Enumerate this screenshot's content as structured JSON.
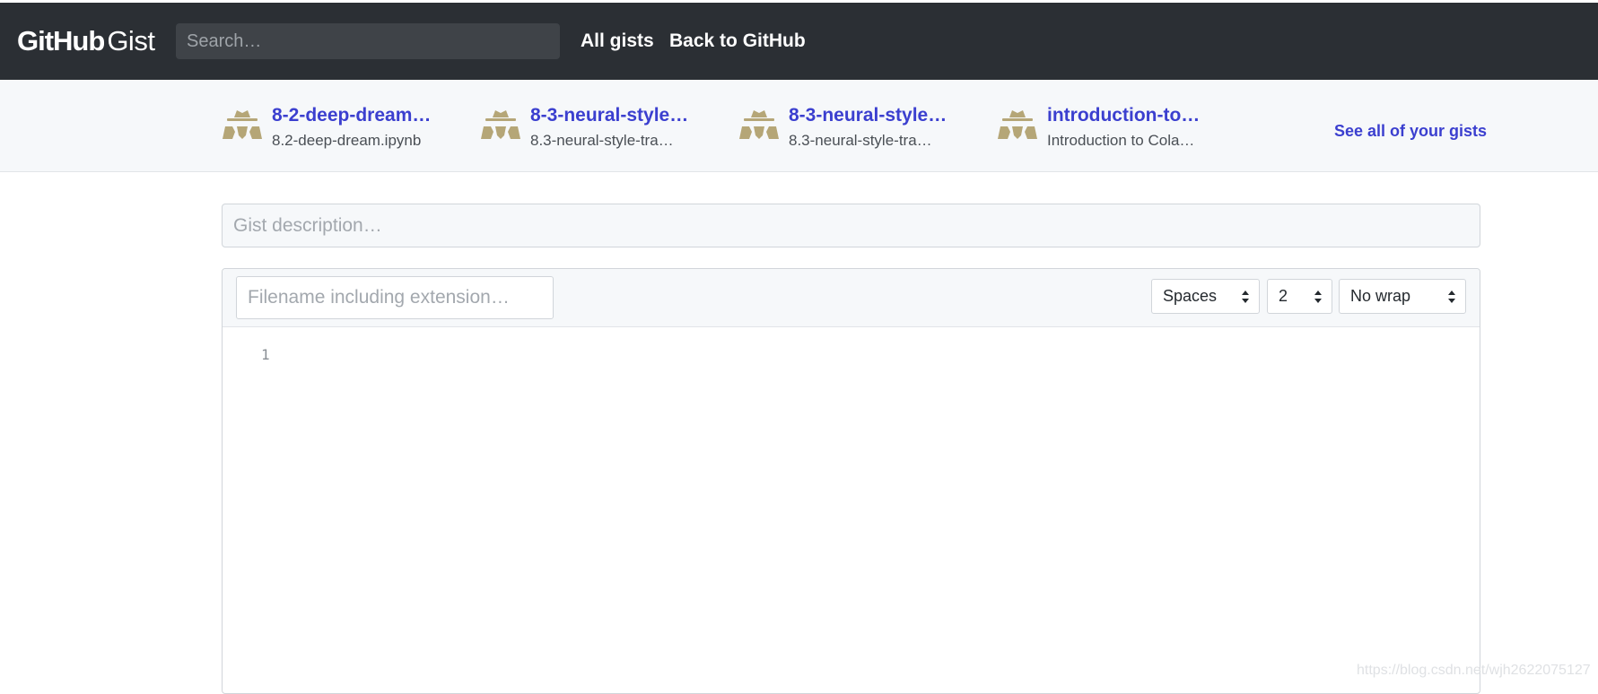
{
  "header": {
    "logo_primary": "GitHub",
    "logo_secondary": "Gist",
    "search_placeholder": "Search…",
    "nav": {
      "all_gists": "All gists",
      "back_to_github": "Back to GitHub"
    }
  },
  "gist_strip": {
    "items": [
      {
        "title": "8-2-deep-dream…",
        "subtitle": "8.2-deep-dream.ipynb",
        "avatar": "spy-avatar-icon"
      },
      {
        "title": "8-3-neural-style…",
        "subtitle": "8.3-neural-style-tra…",
        "avatar": "spy-avatar-icon"
      },
      {
        "title": "8-3-neural-style…",
        "subtitle": "8.3-neural-style-tra…",
        "avatar": "spy-avatar-icon"
      },
      {
        "title": "introduction-to…",
        "subtitle": "Introduction to Cola…",
        "avatar": "spy-avatar-icon"
      }
    ],
    "see_all": "See all of your gists"
  },
  "form": {
    "description_placeholder": "Gist description…",
    "filename_placeholder": "Filename including extension…",
    "indent_mode": "Spaces",
    "indent_size": "2",
    "wrap_mode": "No wrap",
    "line_numbers": [
      "1"
    ]
  },
  "watermark": "https://blog.csdn.net/wjh2622075127",
  "colors": {
    "header_bg": "#2b2f34",
    "link": "#3b3fcf",
    "avatar": "#b5a677"
  }
}
